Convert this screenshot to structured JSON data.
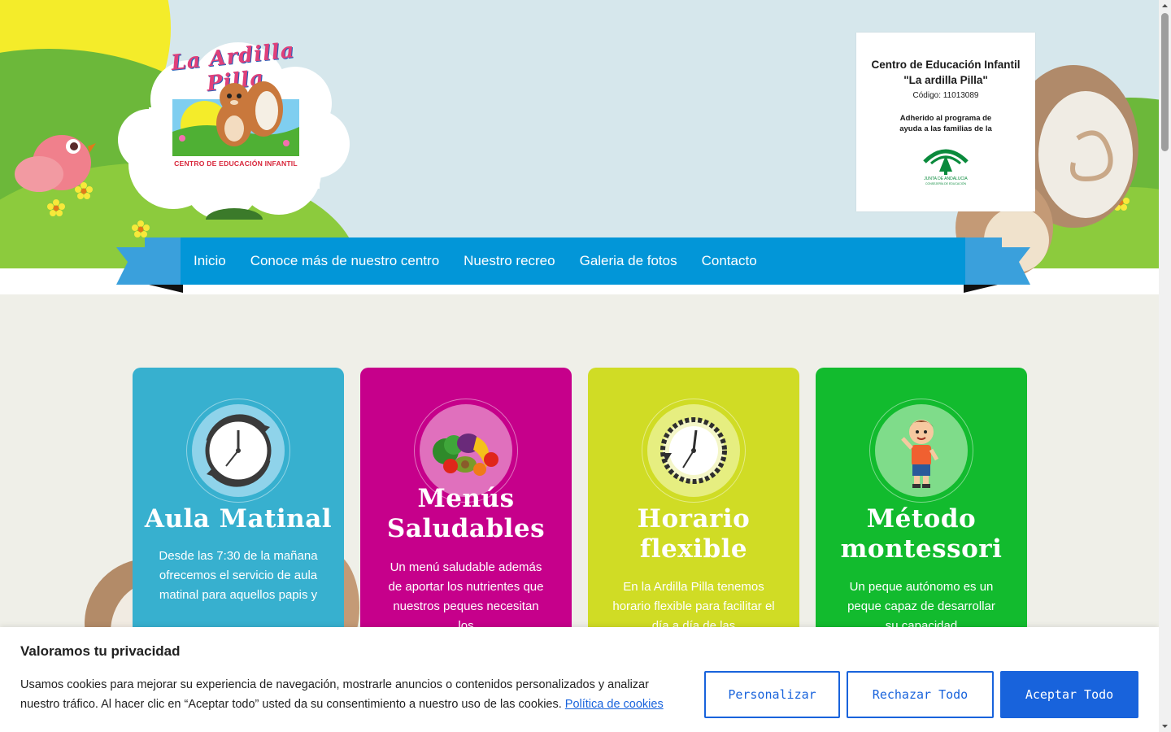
{
  "header": {
    "logo_title": "La Ardilla Pilla",
    "logo_subtitle": "CENTRO DE EDUCACIÓN INFANTIL",
    "info_card": {
      "title_line1": "Centro de Educación Infantil",
      "title_line2": "\"La ardilla Pilla\"",
      "code": "Código: 11013089",
      "adherido_line1": "Adherido al programa de",
      "adherido_line2": "ayuda a las familias de la",
      "junta_line1": "JUNTA DE ANDALUCIA",
      "junta_line2": "CONSEJERÍA DE EDUCACIÓN"
    }
  },
  "nav": {
    "items": [
      {
        "label": "Inicio"
      },
      {
        "label": "Conoce más de nuestro centro"
      },
      {
        "label": "Nuestro recreo"
      },
      {
        "label": "Galeria de fotos"
      },
      {
        "label": "Contacto"
      }
    ]
  },
  "cards": [
    {
      "title_line1": "Aula Matinal",
      "title_line2": "",
      "text": "Desde las 7:30 de la mañana ofrecemos el servicio de aula matinal para aquellos papis y",
      "color": "#37b0cf",
      "icon": "clock-icon"
    },
    {
      "title_line1": "Menús",
      "title_line2": "Saludables",
      "text": "Un menú saludable además de aportar los nutrientes que nuestros peques necesitan los",
      "color": "#c6008b",
      "icon": "vegetables-icon"
    },
    {
      "title_line1": "Horario",
      "title_line2": "flexible",
      "text": "En la Ardilla Pilla tenemos horario flexible para facilitar el día a día de las",
      "color": "#d0dc25",
      "icon": "clock-icon"
    },
    {
      "title_line1": "Método",
      "title_line2": "montessori",
      "text": "Un peque autónomo es un peque capaz de desarrollar su capacidad",
      "color": "#12bb2e",
      "icon": "child-icon"
    }
  ],
  "cookie_banner": {
    "title": "Valoramos tu privacidad",
    "text": "Usamos cookies para mejorar su experiencia de navegación, mostrarle anuncios o contenidos personalizados y analizar nuestro tráfico. Al hacer clic en “Aceptar todo” usted da su consentimiento a nuestro uso de las cookies.",
    "link": "Política de cookies",
    "buttons": {
      "customize": "Personalizar",
      "reject": "Rechazar Todo",
      "accept": "Aceptar Todo"
    },
    "accent_color": "#1863dc"
  }
}
